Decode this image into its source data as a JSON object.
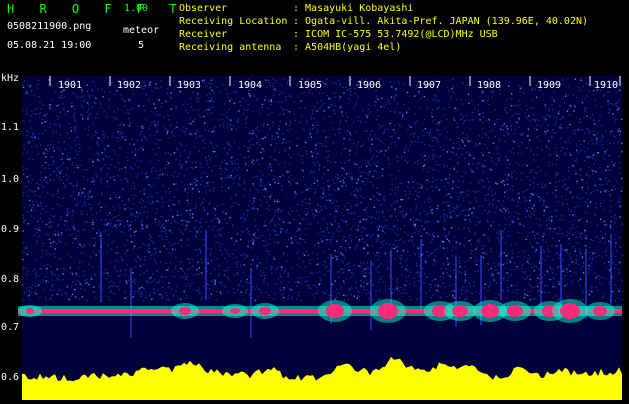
{
  "header": {
    "app_name": "H R O F F T",
    "version": "1.00",
    "filename": "0508211900.png",
    "datetime": "05.08.21 19:00",
    "meteor_label": "meteor",
    "meteor_count": "5",
    "info": [
      {
        "label": "Observer",
        "value": ": Masayuki Kobayashi"
      },
      {
        "label": "Receiving Location",
        "value": ": Ogata-vill. Akita-Pref. JAPAN (139.96E, 40.02N)"
      },
      {
        "label": "Receiver",
        "value": ": ICOM IC-575 53.7492(@LCD)MHz USB"
      },
      {
        "label": "Receiving antenna",
        "value": ": A504HB(yagi 4el)"
      }
    ]
  },
  "plot": {
    "unit": "kHz",
    "y_ticks": [
      "1.1",
      "1.0",
      "0.9",
      "0.8",
      "0.7",
      "0.6"
    ],
    "x_ticks": [
      "1901",
      "1902",
      "1903",
      "1904",
      "1905",
      "1906",
      "1907",
      "1908",
      "1909",
      "1910"
    ],
    "colors": {
      "background": "#00003a",
      "noise": "#1a2a9a",
      "signal": "#ff2a7a",
      "halo": "#00ffd0",
      "level": "#ffff00",
      "text": "#ffffff",
      "accent": "#00ff00"
    }
  }
}
